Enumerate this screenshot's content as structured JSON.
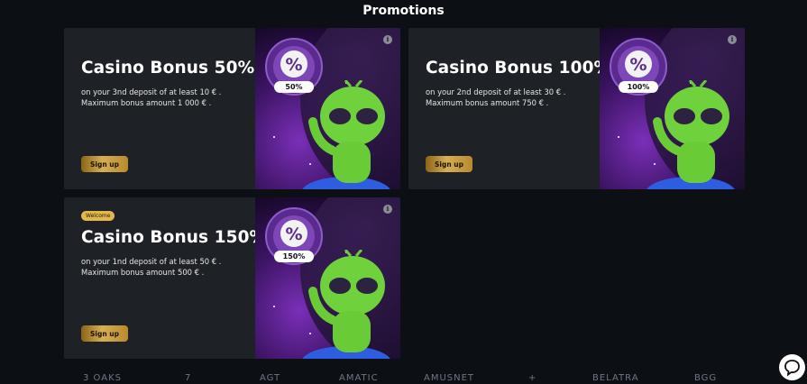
{
  "page": {
    "title": "Promotions"
  },
  "promotions": [
    {
      "badge": "",
      "title": "Casino Bonus 50%.",
      "description": "on your 3nd deposit of at least 10 € . Maximum bonus amount 1 000 € .",
      "button_label": "Sign up",
      "medal_label": "50%"
    },
    {
      "badge": "",
      "title": "Casino Bonus 100%.",
      "description": "on your 2nd deposit of at least 30 € . Maximum bonus amount 750 € .",
      "button_label": "Sign up",
      "medal_label": "100%"
    },
    {
      "badge": "Welcome",
      "title": "Casino Bonus 150%.",
      "description": "on your 1nd deposit of at least 50 € . Maximum bonus amount 500 € .",
      "button_label": "Sign up",
      "medal_label": "150%"
    }
  ],
  "info_icon_glyph": "i",
  "providers": [
    "3 OAKS",
    "7",
    "AGT",
    "AMATIC",
    "AMUSNET",
    "+",
    "BELATRA",
    "BGG"
  ],
  "icons": {
    "info": "info-icon",
    "chat": "chat-bubble-icon",
    "medal": "percent-medal-icon"
  },
  "colors": {
    "background": "#0c0f14",
    "card": "#1e2126",
    "button_gold": "#d7ae54",
    "badge": "#e3b74a"
  }
}
